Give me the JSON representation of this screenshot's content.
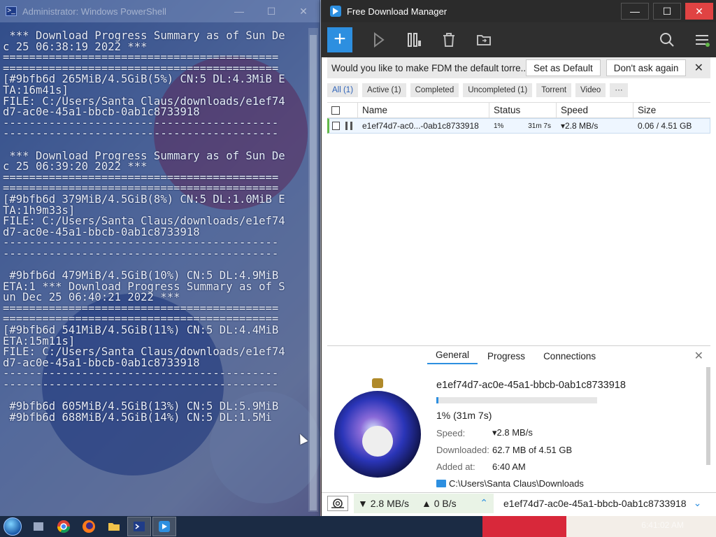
{
  "powershell": {
    "title": "Administrator: Windows PowerShell",
    "lines": [
      " *** Download Progress Summary as of Sun De",
      "c 25 06:38:19 2022 ***",
      "==========================================",
      "==========================================",
      "[#9bfb6d 265MiB/4.5GiB(5%) CN:5 DL:4.3MiB E",
      "TA:16m41s]",
      "FILE: C:/Users/Santa Claus/downloads/e1ef74",
      "d7-ac0e-45a1-bbcb-0ab1c8733918",
      "------------------------------------------",
      "------------------------------------------",
      "",
      " *** Download Progress Summary as of Sun De",
      "c 25 06:39:20 2022 ***",
      "==========================================",
      "==========================================",
      "[#9bfb6d 379MiB/4.5GiB(8%) CN:5 DL:1.0MiB E",
      "TA:1h9m33s]",
      "FILE: C:/Users/Santa Claus/downloads/e1ef74",
      "d7-ac0e-45a1-bbcb-0ab1c8733918",
      "------------------------------------------",
      "------------------------------------------",
      "",
      " #9bfb6d 479MiB/4.5GiB(10%) CN:5 DL:4.9MiB",
      "ETA:1 *** Download Progress Summary as of S",
      "un Dec 25 06:40:21 2022 ***",
      "==========================================",
      "==========================================",
      "[#9bfb6d 541MiB/4.5GiB(11%) CN:5 DL:4.4MiB",
      "ETA:15m11s]",
      "FILE: C:/Users/Santa Claus/downloads/e1ef74",
      "d7-ac0e-45a1-bbcb-0ab1c8733918",
      "------------------------------------------",
      "------------------------------------------",
      "",
      " #9bfb6d 605MiB/4.5GiB(13%) CN:5 DL:5.9MiB",
      " #9bfb6d 688MiB/4.5GiB(14%) CN:5 DL:1.5Mi"
    ]
  },
  "fdm": {
    "title": "Free Download Manager",
    "window_controls": {
      "minimize": "—",
      "maximize": "☐",
      "close": "✕"
    },
    "toolbar": {
      "add_label": "+"
    },
    "banner": {
      "message": "Would you like to make FDM the default torre...",
      "set_default": "Set as Default",
      "dont_ask": "Don't ask again",
      "close": "✕"
    },
    "filters": [
      {
        "label": "All (1)",
        "active": true
      },
      {
        "label": "Active (1)",
        "active": false
      },
      {
        "label": "Completed",
        "active": false
      },
      {
        "label": "Uncompleted (1)",
        "active": false
      },
      {
        "label": "Torrent",
        "active": false
      },
      {
        "label": "Video",
        "active": false
      },
      {
        "label": "···",
        "active": false
      }
    ],
    "table": {
      "columns": [
        "Name",
        "Status",
        "Speed",
        "Size"
      ],
      "rows": [
        {
          "name": "e1ef74d7-ac0...-0ab1c8733918",
          "percent": "1%",
          "eta": "31m 7s",
          "speed": "▾2.8 MB/s",
          "size": "0.06 / 4.51 GB"
        }
      ]
    },
    "details": {
      "tabs": [
        "General",
        "Progress",
        "Connections"
      ],
      "active_tab": "General",
      "close": "✕",
      "file_name": "e1ef74d7-ac0e-45a1-bbcb-0ab1c8733918",
      "progress_fraction": 0.014,
      "progress_text": "1% (31m 7s)",
      "speed_label": "Speed:",
      "speed_value": "▾2.8 MB/s",
      "downloaded_label": "Downloaded:",
      "downloaded_value": "62.7 MB of 4.51 GB",
      "added_label": "Added at:",
      "added_value": "6:40 AM",
      "folder": "C:\\Users\\Santa Claus\\Downloads"
    },
    "status_bar": {
      "down_speed": "▼ 2.8 MB/s",
      "up_speed": "▲ 0 B/s",
      "current_file": "e1ef74d7-ac0e-45a1-bbcb-0ab1c8733918"
    }
  },
  "taskbar": {
    "clock": "6:41:02 AM"
  },
  "colors": {
    "accent": "#2d8fe0",
    "fdm_dark": "#2b2b2b",
    "close_red": "#e04343",
    "active_green": "#63b94a"
  }
}
